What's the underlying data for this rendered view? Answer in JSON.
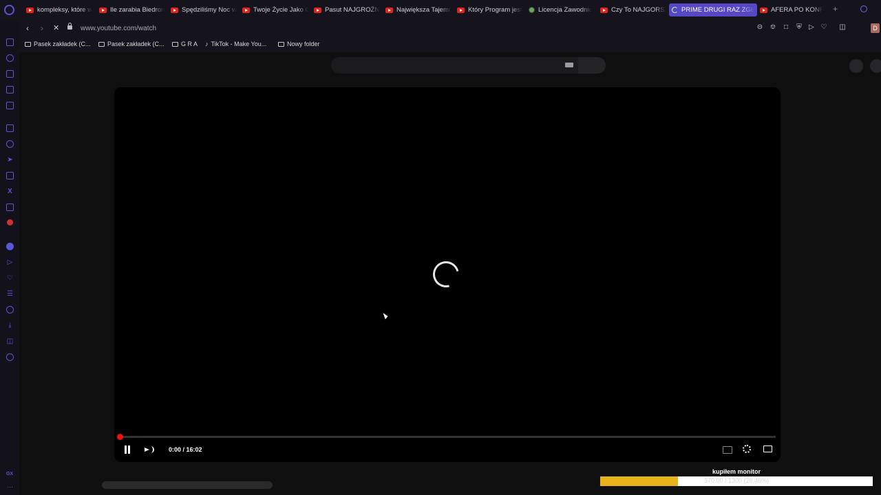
{
  "browser": {
    "tabs": [
      {
        "label": "kompleksy, które w",
        "icon": "youtube-icon"
      },
      {
        "label": "Ile zarabia Biedron",
        "icon": "youtube-icon"
      },
      {
        "label": "Spędziliśmy Noc w",
        "icon": "youtube-icon"
      },
      {
        "label": "Twoje Życie Jako C",
        "icon": "youtube-icon"
      },
      {
        "label": "Pasut NAJGROŹNI",
        "icon": "youtube-icon"
      },
      {
        "label": "Największa Tajemn",
        "icon": "youtube-icon"
      },
      {
        "label": "Który Program jest",
        "icon": "youtube-icon"
      },
      {
        "label": "Licencja Zawodnic",
        "icon": "globe-icon"
      },
      {
        "label": "Czy To NAJGORSZ",
        "icon": "youtube-icon"
      },
      {
        "label": "PRIME DRUGI RAZ ZGŁOS",
        "icon": "loading-icon",
        "active": true
      },
      {
        "label": "AFERA PO KONFER",
        "icon": "youtube-icon"
      }
    ],
    "url": "www.youtube.com/watch",
    "avatar_letter": "D",
    "accent_color": "#5648c4",
    "bookmarks": [
      {
        "label": "Pasek zakładek (C...",
        "icon": "folder-icon"
      },
      {
        "label": "Pasek zakładek (C...",
        "icon": "folder-icon"
      },
      {
        "label": "G R A",
        "icon": "folder-icon"
      },
      {
        "label": "TikTok - Make You...",
        "icon": "tiktok-icon"
      },
      {
        "label": "Nowy folder",
        "icon": "folder-icon"
      }
    ],
    "sidebar_bottom_label": "GX"
  },
  "player": {
    "time_current": "0:00",
    "time_separator": " / ",
    "time_total": "16:02",
    "time_display": "0:00 / 16:02",
    "state": "loading",
    "progress_color": "#e11111"
  },
  "goal": {
    "title": "kupiłem monitor",
    "text": "370.00 / 1300 (28.46%)",
    "fraction": 0.2846,
    "fill_color": "#e8b21a"
  }
}
